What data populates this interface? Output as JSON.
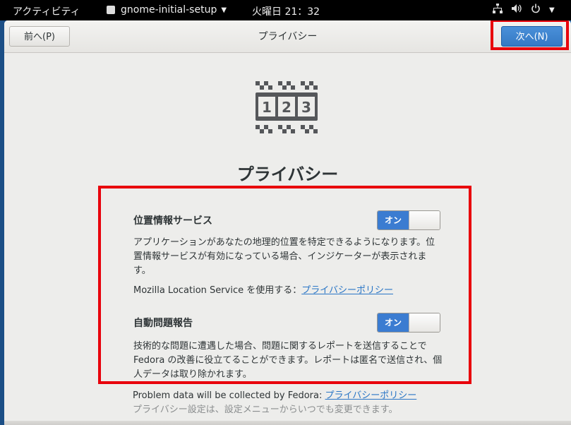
{
  "topbar": {
    "activities": "アクティビティ",
    "app_name": "gnome-initial-setup",
    "clock": "火曜日 21：32"
  },
  "header": {
    "prev_label": "前へ(P)",
    "title": "プライバシー",
    "next_label": "次へ(N)"
  },
  "page": {
    "heading": "プライバシー",
    "logo_digits": [
      "1",
      "2",
      "3"
    ]
  },
  "location": {
    "title": "位置情報サービス",
    "switch_label": "オン",
    "description": "アプリケーションがあなたの地理的位置を特定できるようになります。位置情報サービスが有効になっている場合、インジケーターが表示されます。",
    "service_text": "Mozilla Location Service を使用する：",
    "policy_link": "プライバシーポリシー"
  },
  "problem": {
    "title": "自動問題報告",
    "switch_label": "オン",
    "description": "技術的な問題に遭遇した場合、問題に関するレポートを送信することで Fedora の改善に役立てることができます。レポートは匿名で送信され、個人データは取り除かれます。"
  },
  "footer": {
    "collected_text": "Problem data will be collected by Fedora: ",
    "policy_link": "プライバシーポリシー",
    "note": "プライバシー設定は、設定メニューからいつでも変更できます。"
  },
  "colors": {
    "accent": "#3b7cd1",
    "highlight": "#e8000b",
    "link": "#2a76c6"
  }
}
